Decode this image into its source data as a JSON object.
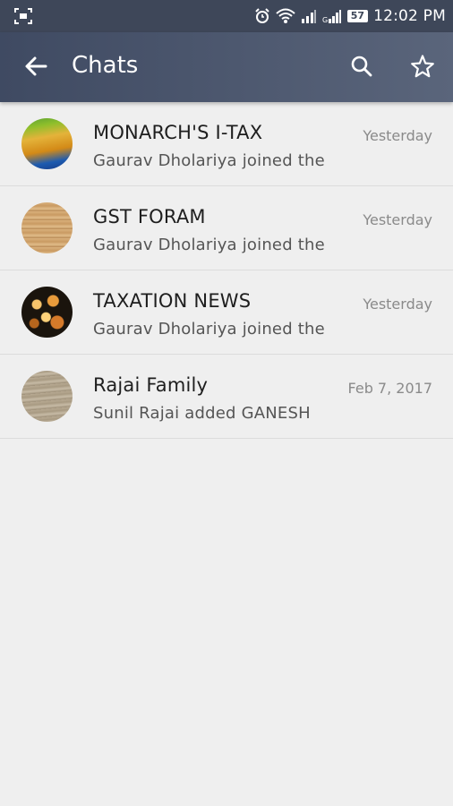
{
  "status_bar": {
    "battery": "57",
    "time": "12:02 PM"
  },
  "toolbar": {
    "title": "Chats"
  },
  "chats": [
    {
      "name": "MONARCH'S I-TAX",
      "preview": "Gaurav Dholariya joined the",
      "time": "Yesterday"
    },
    {
      "name": "GST FORAM",
      "preview": "Gaurav Dholariya joined the",
      "time": "Yesterday"
    },
    {
      "name": "TAXATION NEWS",
      "preview": "Gaurav Dholariya joined the",
      "time": "Yesterday"
    },
    {
      "name": "Rajai Family",
      "preview": "Sunil Rajai added GANESH",
      "time": "Feb 7, 2017"
    }
  ],
  "colors": {
    "toolbar": "#4a5468",
    "status_bar": "#3e4759",
    "background": "#efefef"
  },
  "icons": {
    "status_left": "screenshot-icon",
    "back": "arrow-left-icon",
    "search": "search-icon",
    "star": "star-icon"
  }
}
